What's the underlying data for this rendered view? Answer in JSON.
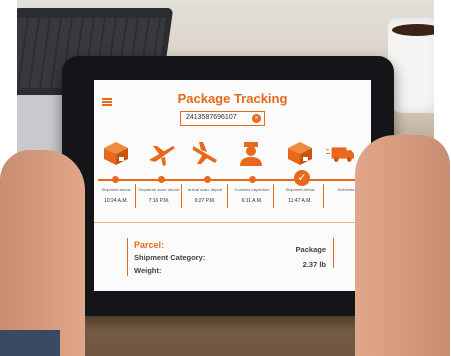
{
  "app": {
    "title": "Package Tracking"
  },
  "search": {
    "tracking_number": "2413587696107"
  },
  "steps": [
    {
      "label": "Shipment arrival",
      "time": "10:24 A.M.",
      "icon": "package-icon"
    },
    {
      "label": "Departure scan: airport",
      "time": "7:16 P.M.",
      "icon": "plane-depart-icon"
    },
    {
      "label": "Arrival scan: airport",
      "time": "9:27 P.M.",
      "icon": "plane-arrive-icon"
    },
    {
      "label": "Customs inspection",
      "time": "6:11 A.M.",
      "icon": "inspector-icon"
    },
    {
      "label": "Shipment arrival",
      "time": "11:47 A.M.",
      "icon": "package-icon"
    },
    {
      "label": "Delivered",
      "time": "",
      "icon": "delivery-truck-icon"
    }
  ],
  "details": {
    "parcel_label": "Parcel:",
    "category_label": "Shipment Category:",
    "category_value": "Package",
    "weight_label": "Weight:",
    "weight_value": "2.37 lb"
  },
  "colors": {
    "accent": "#e8681c"
  }
}
